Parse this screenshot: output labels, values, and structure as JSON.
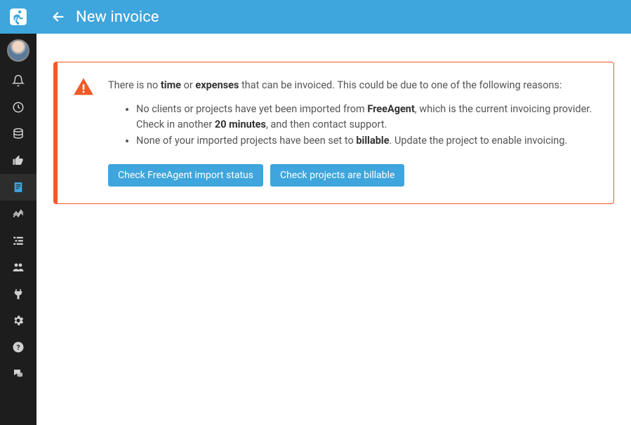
{
  "header": {
    "title": "New invoice"
  },
  "alert": {
    "intro_pre": "There is no ",
    "intro_b1": "time",
    "intro_mid": " or ",
    "intro_b2": "expenses",
    "intro_post": " that can be invoiced. This could be due to one of the following reasons:",
    "reason1_pre": "No clients or projects have yet been imported from ",
    "reason1_b1": "FreeAgent",
    "reason1_mid": ", which is the current invoicing provider. Check in another ",
    "reason1_b2": "20 minutes",
    "reason1_post": ", and then contact support.",
    "reason2_pre": "None of your imported projects have been set to ",
    "reason2_b1": "billable",
    "reason2_post": ". Update the project to enable invoicing.",
    "btn_import": "Check FreeAgent import status",
    "btn_billable": "Check projects are billable"
  }
}
